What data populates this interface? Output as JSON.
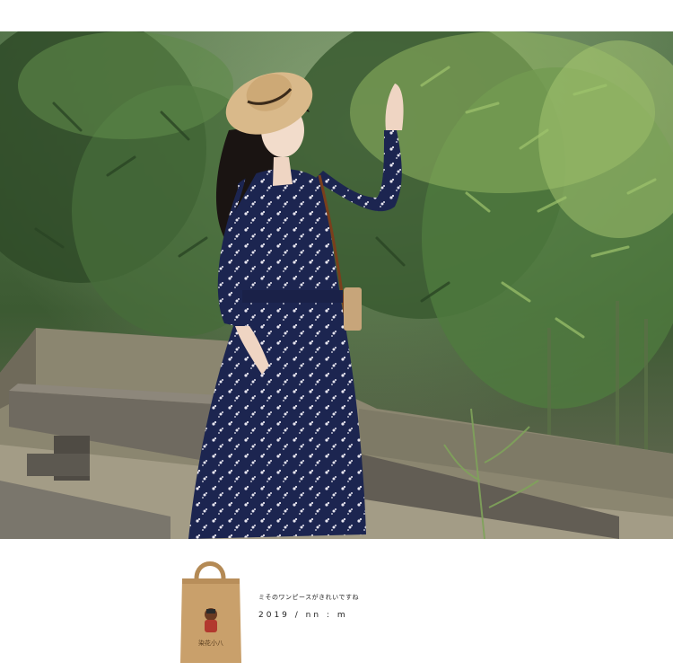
{
  "footer": {
    "caption": "ミそのワンピースがきれいですね",
    "date": "2019 / nn : m",
    "bag_logo_text": "染花小八"
  },
  "palette": {
    "foliage_dark": "#2e4a26",
    "foliage_light": "#8fb460",
    "dress_navy": "#1c2550",
    "hat_straw": "#d9b98a",
    "bench_gray": "#6f6a60",
    "bag_kraft": "#c9a06b"
  }
}
